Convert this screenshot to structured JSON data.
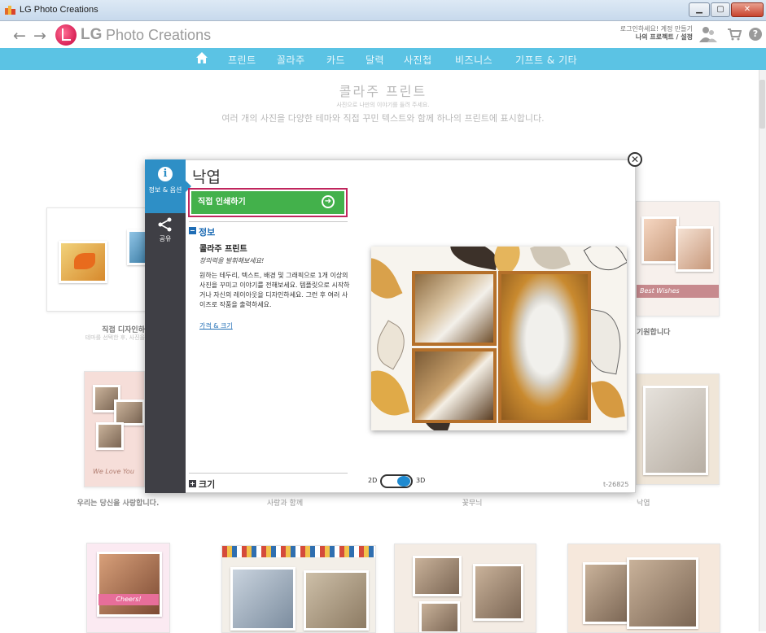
{
  "window": {
    "title": "LG Photo Creations",
    "controls": [
      "minimize",
      "maximize",
      "close"
    ]
  },
  "header": {
    "logo_lg": "LG",
    "logo_product": "Photo Creations",
    "login_text": "로그인하세요! 계정 만들기",
    "projects_text": "나의 프로젝트 / 설정",
    "icons": [
      "back-arrow-icon",
      "forward-arrow-icon",
      "user-icon",
      "cart-icon",
      "help-icon"
    ]
  },
  "nav": {
    "items": [
      "프린트",
      "꼴라주",
      "카드",
      "달력",
      "사진첩",
      "비즈니스",
      "기프트 & 기타"
    ]
  },
  "page": {
    "title": "콜라주 프린트",
    "subtitle_small": "사진으로 나만의 이야기를 들려 주세요.",
    "subtitle": "여러 개의 사진을 다양한 테마와 직접 꾸민 텍스트와 함께 하나의 프린트에 표시합니다."
  },
  "tiles": {
    "row1": [
      {
        "caption": "직접 디자인하",
        "sub": "테마를 선택한 후, 사진을"
      },
      {
        "caption": "기원합니다",
        "sub": ""
      }
    ],
    "row2": [
      {
        "caption": "우리는 당신을 사랑합니다.",
        "tile_text": "We Love You"
      },
      {
        "caption": "사랑과 함께"
      },
      {
        "caption": "꽃무늬"
      },
      {
        "caption": "낙엽"
      }
    ],
    "row3_texts": [
      "Cheers!"
    ],
    "card_text": "Best Wishes"
  },
  "modal": {
    "side": {
      "info_label": "정보 & 옵션",
      "share_label": "공유"
    },
    "title": "낙엽",
    "cta_label": "직접 인쇄하기",
    "section_info": "정보",
    "product_title": "콜라주 프린트",
    "product_tagline": "창의력을 발휘해보세요!",
    "product_desc": "원하는 테두리, 텍스트, 배경 및 그래픽으로 1개 이상의 사진을 꾸미고 이야기를 전해보세요. 템플릿으로 시작하거나 자신의 레이아웃을 디자인하세요. 그런 후 여러 사이즈로 작품을 출력하세요.",
    "price_link": "가격 & 크기",
    "section_size": "크기",
    "toggle_2d": "2D",
    "toggle_3d": "3D",
    "item_code": "t-26825"
  }
}
